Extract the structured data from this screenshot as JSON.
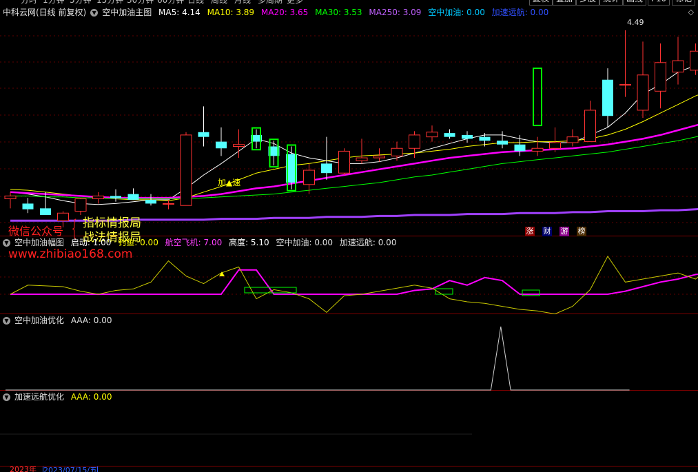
{
  "topbar": {
    "tabs": [
      "分时",
      "1分钟",
      "5分钟",
      "15分钟",
      "30分钟",
      "60分钟",
      "日线",
      "周线",
      "月线",
      "多周期",
      "更多"
    ],
    "buttons": [
      "复权",
      "叠加",
      "多股",
      "统计",
      "画线",
      "F10",
      "标记"
    ]
  },
  "main_panel": {
    "stock": "中科云网(日线 前复权)",
    "indicator": "空中加油主图",
    "ma5": "MA5: 4.14",
    "ma10": "MA10: 3.89",
    "ma20": "MA20: 3.65",
    "ma30": "MA30: 3.53",
    "ma250": "MA250: 3.09",
    "kzjy": "空中加油: 0.00",
    "jsyh": "加速远航: 0.00",
    "high_label": "4.49",
    "jia_su_label": "加▲速",
    "tags": [
      "涨",
      "财",
      "游",
      "榜"
    ],
    "colors": {
      "ma5": "#ffffff",
      "ma10": "#ffff00",
      "ma20": "#ff00ff",
      "ma30": "#00ff00",
      "ma250": "#a040ff",
      "up": "#ff3232",
      "down": "#54ffff",
      "kzjy": "#00ffff",
      "jsyh": "#3050ff"
    }
  },
  "panel2": {
    "indicator": "空中加油幅图",
    "qidong": "启动: 1.00",
    "dixian": "钓鱼: 0.00",
    "hangkong": "航空飞机: 7.00",
    "gaodu": "高度: 5.10",
    "kzjy": "空中加油: 0.00",
    "jsyh": "加速远航: 0.00"
  },
  "panel3": {
    "indicator": "空中加油优化",
    "aaa": "AAA: 0.00"
  },
  "panel4": {
    "indicator": "加速远航优化",
    "aaa": "AAA: 0.00"
  },
  "watermark": {
    "wechat": "微信公众号",
    "brace": "{",
    "line1": "指标情报局",
    "line2": "战法情报局",
    "url": "www.zhibiao168.com"
  },
  "bottom": {
    "left": "2023年",
    "date": "2023/07/15/五"
  },
  "chart_data": [
    {
      "type": "candlestick",
      "title": "中科云网(日线 前复权)",
      "annotations": [
        "4.49",
        "加▲速"
      ],
      "candles": [
        {
          "o": 2.85,
          "h": 2.92,
          "l": 2.75,
          "c": 2.88
        },
        {
          "o": 2.8,
          "h": 2.86,
          "l": 2.7,
          "c": 2.74
        },
        {
          "o": 2.75,
          "h": 2.92,
          "l": 2.7,
          "c": 2.68
        },
        {
          "o": 2.62,
          "h": 2.72,
          "l": 2.55,
          "c": 2.7
        },
        {
          "o": 2.72,
          "h": 2.86,
          "l": 2.68,
          "c": 2.85
        },
        {
          "o": 2.85,
          "h": 2.92,
          "l": 2.8,
          "c": 2.88
        },
        {
          "o": 2.88,
          "h": 2.95,
          "l": 2.82,
          "c": 2.86
        },
        {
          "o": 2.9,
          "h": 2.96,
          "l": 2.84,
          "c": 2.84
        },
        {
          "o": 2.84,
          "h": 2.9,
          "l": 2.78,
          "c": 2.8
        },
        {
          "o": 2.8,
          "h": 2.84,
          "l": 2.74,
          "c": 2.8
        },
        {
          "o": 2.78,
          "h": 3.55,
          "l": 2.78,
          "c": 3.52
        },
        {
          "o": 3.55,
          "h": 3.82,
          "l": 3.4,
          "c": 3.5
        },
        {
          "o": 3.45,
          "h": 3.6,
          "l": 3.3,
          "c": 3.38
        },
        {
          "o": 3.4,
          "h": 3.58,
          "l": 3.28,
          "c": 3.42
        },
        {
          "o": 3.52,
          "h": 3.58,
          "l": 3.38,
          "c": 3.45
        },
        {
          "o": 3.4,
          "h": 3.46,
          "l": 3.2,
          "c": 3.3
        },
        {
          "o": 3.32,
          "h": 3.4,
          "l": 2.95,
          "c": 3.02
        },
        {
          "o": 3.0,
          "h": 3.22,
          "l": 2.9,
          "c": 3.15
        },
        {
          "o": 3.22,
          "h": 3.5,
          "l": 3.05,
          "c": 3.12
        },
        {
          "o": 3.12,
          "h": 3.38,
          "l": 3.1,
          "c": 3.35
        },
        {
          "o": 3.25,
          "h": 3.48,
          "l": 3.22,
          "c": 3.28
        },
        {
          "o": 3.28,
          "h": 3.38,
          "l": 3.24,
          "c": 3.3
        },
        {
          "o": 3.3,
          "h": 3.45,
          "l": 3.25,
          "c": 3.38
        },
        {
          "o": 3.38,
          "h": 3.56,
          "l": 3.28,
          "c": 3.52
        },
        {
          "o": 3.5,
          "h": 3.62,
          "l": 3.45,
          "c": 3.55
        },
        {
          "o": 3.54,
          "h": 3.58,
          "l": 3.48,
          "c": 3.5
        },
        {
          "o": 3.52,
          "h": 3.56,
          "l": 3.44,
          "c": 3.48
        },
        {
          "o": 3.5,
          "h": 3.54,
          "l": 3.4,
          "c": 3.46
        },
        {
          "o": 3.46,
          "h": 3.56,
          "l": 3.38,
          "c": 3.42
        },
        {
          "o": 3.42,
          "h": 3.52,
          "l": 3.3,
          "c": 3.35
        },
        {
          "o": 3.35,
          "h": 3.5,
          "l": 3.3,
          "c": 3.38
        },
        {
          "o": 3.38,
          "h": 3.6,
          "l": 3.34,
          "c": 3.44
        },
        {
          "o": 3.44,
          "h": 3.58,
          "l": 3.4,
          "c": 3.5
        },
        {
          "o": 3.45,
          "h": 3.88,
          "l": 3.45,
          "c": 3.78
        },
        {
          "o": 4.1,
          "h": 4.22,
          "l": 3.6,
          "c": 3.72
        },
        {
          "o": 4.05,
          "h": 4.62,
          "l": 3.92,
          "c": 4.05
        },
        {
          "o": 3.78,
          "h": 4.5,
          "l": 3.7,
          "c": 4.15
        },
        {
          "o": 3.98,
          "h": 4.48,
          "l": 3.8,
          "c": 4.28
        },
        {
          "o": 4.18,
          "h": 4.55,
          "l": 4.05,
          "c": 4.3
        },
        {
          "o": 4.2,
          "h": 4.48,
          "l": 4.15,
          "c": 4.4
        },
        {
          "o": 4.42,
          "h": 4.72,
          "l": 4.18,
          "c": 4.38
        },
        {
          "o": 4.42,
          "h": 4.55,
          "l": 4.28,
          "c": 4.35
        }
      ],
      "series": [
        {
          "name": "MA5",
          "values": [
            2.92,
            2.9,
            2.87,
            2.83,
            2.8,
            2.79,
            2.8,
            2.82,
            2.84,
            2.84,
            2.96,
            3.1,
            3.22,
            3.35,
            3.48,
            3.43,
            3.33,
            3.28,
            3.25,
            3.22,
            3.22,
            3.24,
            3.28,
            3.33,
            3.38,
            3.43,
            3.48,
            3.52,
            3.52,
            3.48,
            3.45,
            3.44,
            3.44,
            3.52,
            3.6,
            3.75,
            3.95,
            4.05,
            4.18,
            4.25,
            4.27,
            4.28
          ]
        },
        {
          "name": "MA10",
          "values": [
            2.95,
            2.94,
            2.92,
            2.9,
            2.88,
            2.86,
            2.85,
            2.84,
            2.84,
            2.83,
            2.86,
            2.92,
            2.98,
            3.05,
            3.12,
            3.16,
            3.2,
            3.22,
            3.25,
            3.28,
            3.3,
            3.31,
            3.32,
            3.33,
            3.35,
            3.37,
            3.4,
            3.42,
            3.44,
            3.44,
            3.45,
            3.45,
            3.46,
            3.48,
            3.52,
            3.58,
            3.66,
            3.75,
            3.84,
            3.93,
            4.0,
            4.06
          ]
        },
        {
          "name": "MA20",
          "values": [
            2.92,
            2.91,
            2.9,
            2.89,
            2.88,
            2.87,
            2.86,
            2.86,
            2.86,
            2.86,
            2.87,
            2.88,
            2.9,
            2.93,
            2.96,
            2.98,
            3.01,
            3.04,
            3.07,
            3.1,
            3.13,
            3.16,
            3.19,
            3.22,
            3.25,
            3.28,
            3.3,
            3.32,
            3.34,
            3.35,
            3.36,
            3.37,
            3.38,
            3.4,
            3.42,
            3.45,
            3.48,
            3.52,
            3.57,
            3.62,
            3.67,
            3.71
          ]
        },
        {
          "name": "MA30",
          "values": [
            2.88,
            2.88,
            2.87,
            2.87,
            2.86,
            2.86,
            2.85,
            2.85,
            2.85,
            2.85,
            2.85,
            2.86,
            2.87,
            2.88,
            2.89,
            2.9,
            2.92,
            2.94,
            2.96,
            2.98,
            3.0,
            3.02,
            3.05,
            3.08,
            3.1,
            3.13,
            3.16,
            3.19,
            3.22,
            3.24,
            3.26,
            3.28,
            3.3,
            3.32,
            3.34,
            3.37,
            3.4,
            3.43,
            3.46,
            3.5,
            3.54,
            3.58
          ]
        },
        {
          "name": "MA250",
          "values": [
            2.62,
            2.62,
            2.62,
            2.62,
            2.62,
            2.62,
            2.62,
            2.63,
            2.63,
            2.63,
            2.63,
            2.63,
            2.64,
            2.64,
            2.64,
            2.65,
            2.65,
            2.65,
            2.66,
            2.66,
            2.66,
            2.67,
            2.67,
            2.68,
            2.68,
            2.68,
            2.69,
            2.69,
            2.69,
            2.7,
            2.7,
            2.7,
            2.71,
            2.71,
            2.72,
            2.72,
            2.72,
            2.73,
            2.73,
            2.74,
            2.75,
            2.76
          ]
        }
      ]
    },
    {
      "type": "line",
      "title": "空中加油幅图",
      "series": [
        {
          "name": "启动",
          "values": [
            0,
            0,
            0,
            0,
            0,
            0,
            0,
            0,
            0,
            0,
            0,
            0,
            0,
            1.6,
            1.6,
            0,
            0,
            0,
            0,
            0,
            0,
            0,
            0,
            0.25,
            0.35,
            0.9,
            0.6,
            1.1,
            0.9,
            0,
            0,
            0,
            0,
            0,
            0,
            0.2,
            0.5,
            0.8,
            1.0,
            1.3,
            1.45,
            1.7
          ]
        },
        {
          "name": "航空飞机",
          "values": [
            0,
            0.6,
            0.55,
            0.5,
            0.2,
            0.0,
            0.25,
            0.35,
            0.8,
            2.2,
            1.2,
            0.7,
            1.4,
            1.8,
            -0.3,
            0.3,
            0.1,
            -0.3,
            -1.2,
            -0.1,
            0.0,
            0.2,
            0.4,
            0.6,
            0.4,
            -0.3,
            -0.5,
            -0.6,
            -0.8,
            -1.0,
            -1.1,
            -1.3,
            -0.8,
            0.3,
            2.5,
            0.8,
            1.0,
            1.2,
            1.4,
            1.0,
            2.0,
            0.8
          ]
        }
      ]
    },
    {
      "type": "line",
      "title": "空中加油优化",
      "series": [
        {
          "name": "AAA",
          "values": [
            0,
            0,
            0,
            0,
            0,
            0,
            0,
            0,
            0,
            0,
            0,
            0,
            0,
            0,
            0,
            0,
            0,
            0,
            0,
            0,
            0,
            0,
            0,
            0,
            0,
            0,
            0,
            0,
            0,
            0,
            0,
            0,
            0,
            0,
            0,
            0,
            0,
            0,
            0,
            0,
            0,
            0,
            0,
            0,
            0,
            0,
            0,
            0,
            0,
            0,
            1,
            0,
            0,
            0,
            0,
            0,
            0,
            0,
            0,
            0,
            0,
            0,
            0,
            0
          ]
        }
      ]
    }
  ]
}
